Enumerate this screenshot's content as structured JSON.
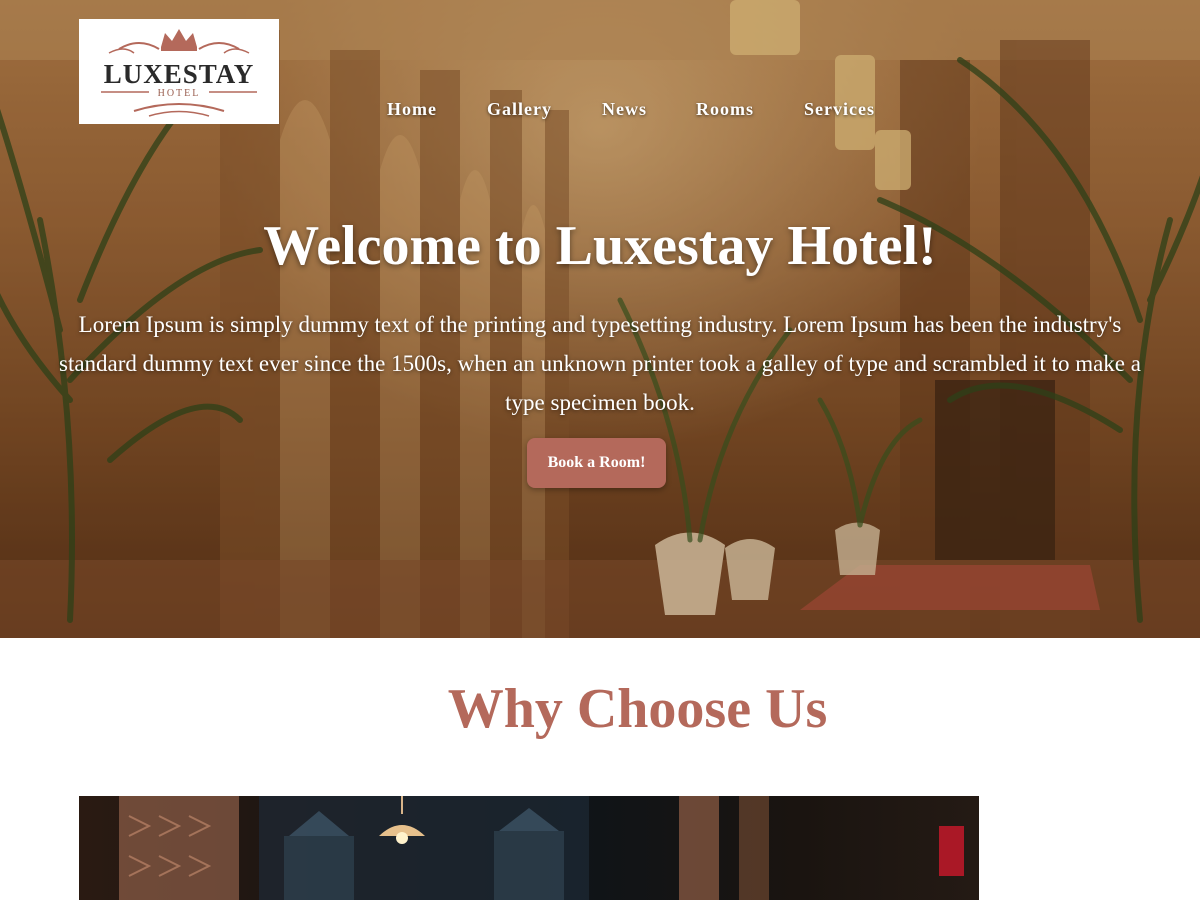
{
  "logo": {
    "title": "LUXESTAY",
    "subtitle": "HOTEL"
  },
  "nav": {
    "items": [
      "Home",
      "Gallery",
      "News",
      "Rooms",
      "Services"
    ]
  },
  "hero": {
    "title": "Welcome to Luxestay Hotel!",
    "text": "Lorem Ipsum is simply dummy text of the printing and typesetting industry. Lorem Ipsum has been the industry's standard dummy text ever since the 1500s, when an unknown printer took a galley of type and scrambled it to make a type specimen book.",
    "button_label": "Book a Room!"
  },
  "why": {
    "title": "Why Choose Us"
  },
  "colors": {
    "accent": "#b4695b",
    "logo_text": "#2a2a2a",
    "nav_text": "#ffffff"
  }
}
